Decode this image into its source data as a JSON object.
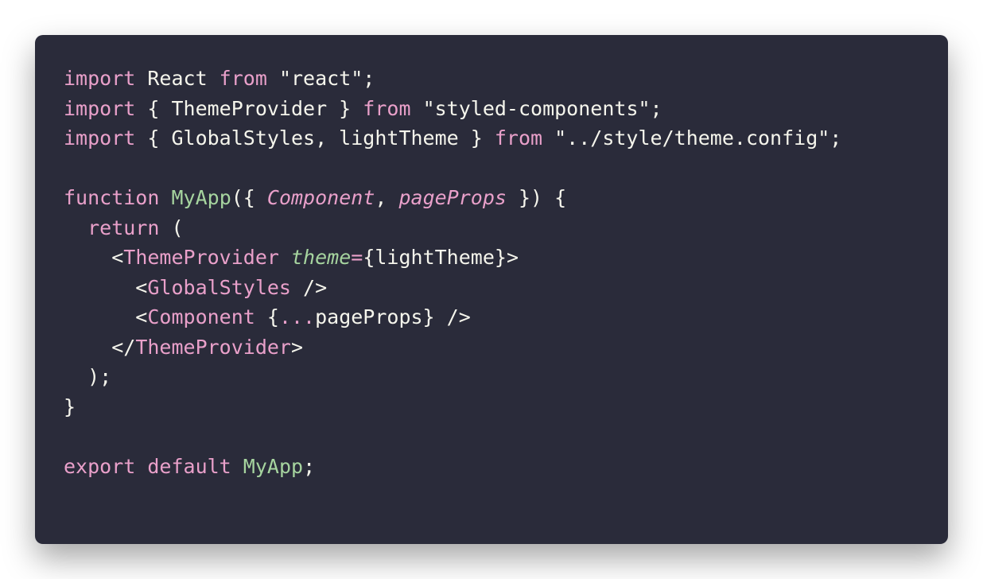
{
  "colors": {
    "background": "#2a2b3a",
    "keyword": "#e9a0ca",
    "function": "#a6d49f",
    "text": "#f5f5ec"
  },
  "lines": [
    [
      {
        "t": "import",
        "c": "kw"
      },
      {
        "t": " React ",
        "c": "plain"
      },
      {
        "t": "from",
        "c": "kw"
      },
      {
        "t": " \"react\";",
        "c": "plain"
      }
    ],
    [
      {
        "t": "import",
        "c": "kw"
      },
      {
        "t": " { ThemeProvider } ",
        "c": "plain"
      },
      {
        "t": "from",
        "c": "kw"
      },
      {
        "t": " \"styled-components\";",
        "c": "plain"
      }
    ],
    [
      {
        "t": "import",
        "c": "kw"
      },
      {
        "t": " { GlobalStyles, lightTheme } ",
        "c": "plain"
      },
      {
        "t": "from",
        "c": "kw"
      },
      {
        "t": " \"../style/theme.config\";",
        "c": "plain"
      }
    ],
    [],
    [
      {
        "t": "function",
        "c": "kw"
      },
      {
        "t": " ",
        "c": "plain"
      },
      {
        "t": "MyApp",
        "c": "fn"
      },
      {
        "t": "({ ",
        "c": "plain"
      },
      {
        "t": "Component",
        "c": "param"
      },
      {
        "t": ", ",
        "c": "plain"
      },
      {
        "t": "pageProps",
        "c": "param"
      },
      {
        "t": " }) {",
        "c": "plain"
      }
    ],
    [
      {
        "t": "  ",
        "c": "plain"
      },
      {
        "t": "return",
        "c": "kw"
      },
      {
        "t": " (",
        "c": "plain"
      }
    ],
    [
      {
        "t": "    <",
        "c": "plain"
      },
      {
        "t": "ThemeProvider",
        "c": "tag"
      },
      {
        "t": " ",
        "c": "plain"
      },
      {
        "t": "theme",
        "c": "attr"
      },
      {
        "t": "=",
        "c": "kw"
      },
      {
        "t": "{lightTheme}>",
        "c": "plain"
      }
    ],
    [
      {
        "t": "      <",
        "c": "plain"
      },
      {
        "t": "GlobalStyles",
        "c": "tag"
      },
      {
        "t": " />",
        "c": "plain"
      }
    ],
    [
      {
        "t": "      <",
        "c": "plain"
      },
      {
        "t": "Component",
        "c": "tag"
      },
      {
        "t": " {",
        "c": "plain"
      },
      {
        "t": "...",
        "c": "kw"
      },
      {
        "t": "pageProps} />",
        "c": "plain"
      }
    ],
    [
      {
        "t": "    </",
        "c": "plain"
      },
      {
        "t": "ThemeProvider",
        "c": "tag"
      },
      {
        "t": ">",
        "c": "plain"
      }
    ],
    [
      {
        "t": "  );",
        "c": "plain"
      }
    ],
    [
      {
        "t": "}",
        "c": "plain"
      }
    ],
    [],
    [
      {
        "t": "export",
        "c": "kw"
      },
      {
        "t": " ",
        "c": "plain"
      },
      {
        "t": "default",
        "c": "kw"
      },
      {
        "t": " ",
        "c": "plain"
      },
      {
        "t": "MyApp",
        "c": "fn"
      },
      {
        "t": ";",
        "c": "plain"
      }
    ]
  ]
}
